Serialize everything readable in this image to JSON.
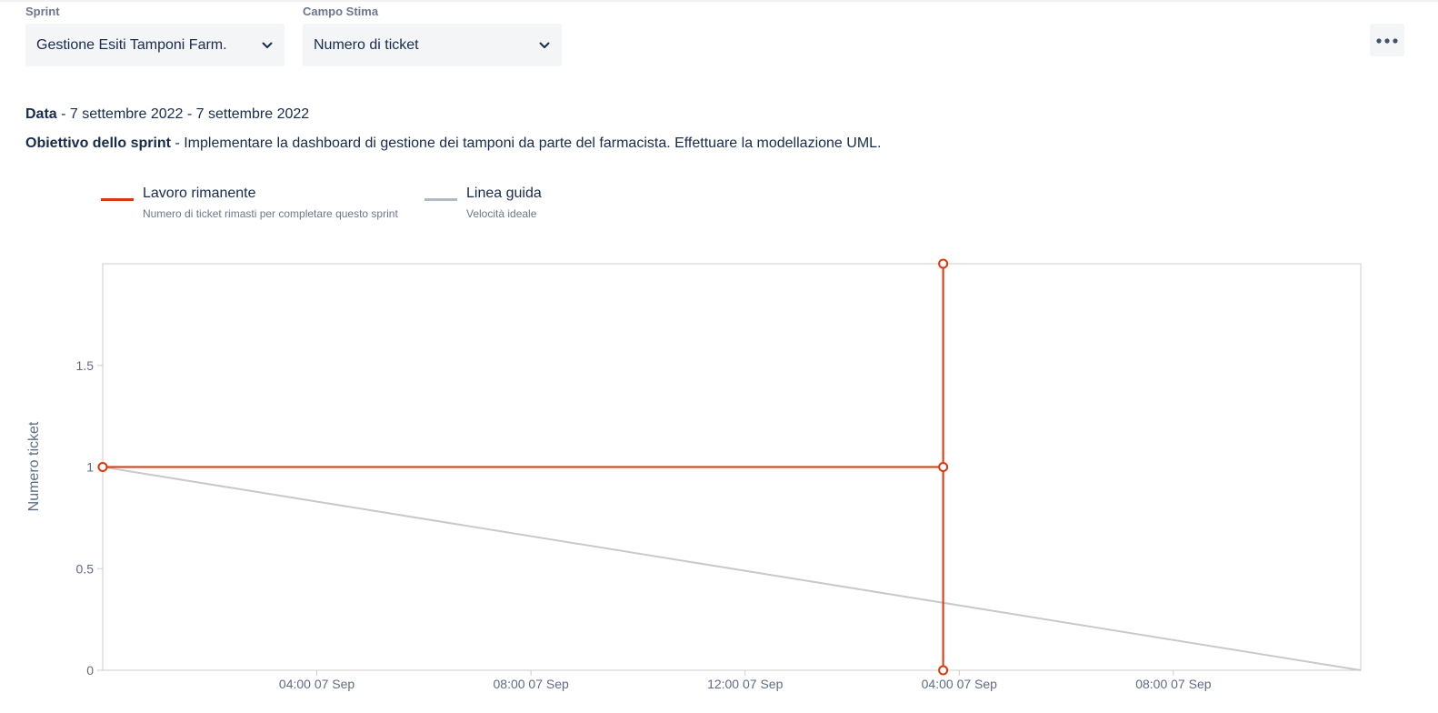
{
  "filters": {
    "sprint_label": "Sprint",
    "sprint_value": "Gestione Esiti Tamponi Farm.",
    "estimate_label": "Campo Stima",
    "estimate_value": "Numero di ticket"
  },
  "more_icon": "more-horizontal-icon",
  "info": {
    "date_label": "Data",
    "date_value": " - 7 settembre 2022 - 7 settembre 2022",
    "goal_label": "Obiettivo dello sprint",
    "goal_value": " - Implementare la dashboard di gestione dei tamponi da parte del farmacista. Effettuare la modellazione UML."
  },
  "legend": [
    {
      "title": "Lavoro rimanente",
      "subtitle": "Numero di ticket rimasti per completare questo sprint",
      "color": "#de350b"
    },
    {
      "title": "Linea guida",
      "subtitle": "Velocità ideale",
      "color": "#b3bac5"
    }
  ],
  "chart_data": {
    "type": "line",
    "ylabel": "Numero ticket",
    "xlabel": "",
    "ylim": [
      0,
      2
    ],
    "y_ticks": [
      0,
      0.5,
      1,
      1.5
    ],
    "x_range_hours": [
      0,
      23.5
    ],
    "x_ticks": [
      {
        "hour": 4,
        "label": "04:00 07 Sep"
      },
      {
        "hour": 8,
        "label": "08:00 07 Sep"
      },
      {
        "hour": 12,
        "label": "12:00 07 Sep"
      },
      {
        "hour": 16,
        "label": "04:00 07 Sep"
      },
      {
        "hour": 20,
        "label": "08:00 07 Sep"
      }
    ],
    "series": [
      {
        "name": "Lavoro rimanente",
        "color": "#de350b",
        "step": true,
        "points": [
          {
            "hour": 0,
            "value": 1
          },
          {
            "hour": 15.7,
            "value": 1
          },
          {
            "hour": 15.7,
            "value": 2
          },
          {
            "hour": 15.7,
            "value": 0
          }
        ]
      },
      {
        "name": "Linea guida",
        "color": "#c7c9cc",
        "points": [
          {
            "hour": 0,
            "value": 1
          },
          {
            "hour": 23.5,
            "value": 0
          }
        ]
      }
    ]
  }
}
